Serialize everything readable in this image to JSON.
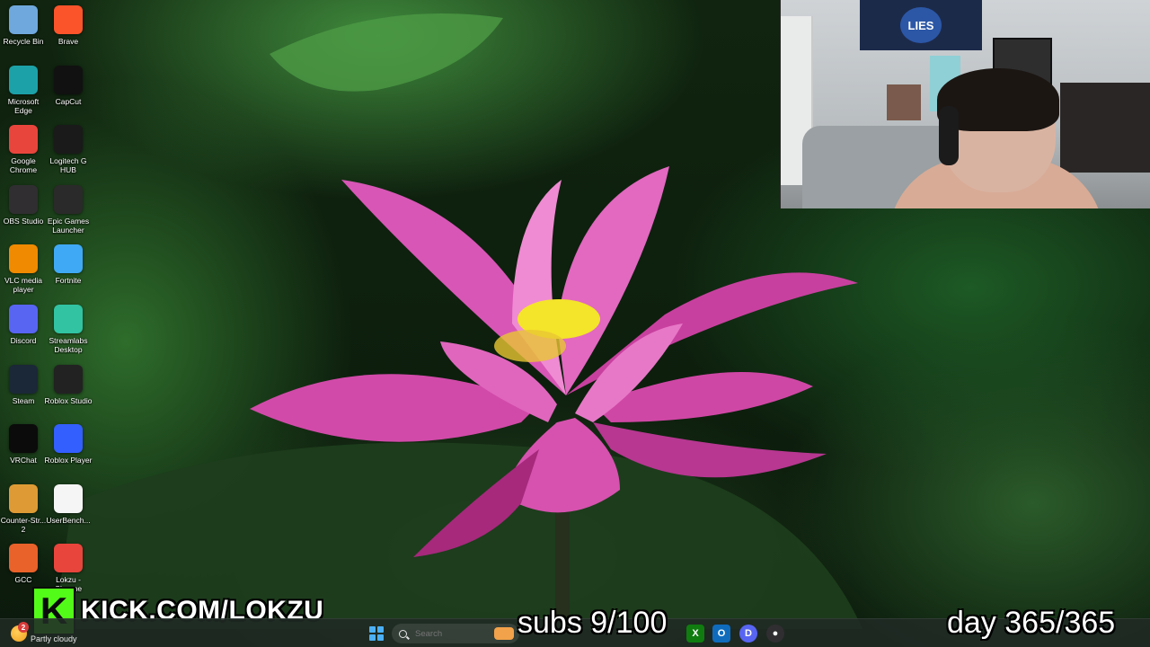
{
  "desktop": {
    "icons": [
      {
        "label": "Recycle Bin",
        "icon": "recycle-bin-icon",
        "color": "#6fa8dc"
      },
      {
        "label": "Brave",
        "icon": "brave-icon",
        "color": "#fb542b"
      },
      {
        "label": "Microsoft Edge",
        "icon": "edge-icon",
        "color": "#1da1a8"
      },
      {
        "label": "CapCut",
        "icon": "capcut-icon",
        "color": "#111111"
      },
      {
        "label": "Google Chrome",
        "icon": "chrome-icon",
        "color": "#e8453c"
      },
      {
        "label": "Logitech G HUB",
        "icon": "logitech-ghub-icon",
        "color": "#1a1a1a"
      },
      {
        "label": "OBS Studio",
        "icon": "obs-icon",
        "color": "#302e31"
      },
      {
        "label": "Epic Games Launcher",
        "icon": "epic-games-icon",
        "color": "#2a2a2a"
      },
      {
        "label": "VLC media player",
        "icon": "vlc-icon",
        "color": "#f08a00"
      },
      {
        "label": "Fortnite",
        "icon": "fortnite-icon",
        "color": "#3fa9f5"
      },
      {
        "label": "Discord",
        "icon": "discord-icon",
        "color": "#5865f2"
      },
      {
        "label": "Streamlabs Desktop",
        "icon": "streamlabs-icon",
        "color": "#31c3a2"
      },
      {
        "label": "Steam",
        "icon": "steam-icon",
        "color": "#1b2838"
      },
      {
        "label": "Roblox Studio",
        "icon": "roblox-studio-icon",
        "color": "#222222"
      },
      {
        "label": "VRChat",
        "icon": "vrchat-icon",
        "color": "#0b0b0b"
      },
      {
        "label": "Roblox Player",
        "icon": "roblox-player-icon",
        "color": "#335fff"
      },
      {
        "label": "Counter-Str... 2",
        "icon": "counter-strike-icon",
        "color": "#de9b35"
      },
      {
        "label": "UserBench...",
        "icon": "userbenchmark-icon",
        "color": "#f5f5f5"
      },
      {
        "label": "GCC",
        "icon": "gcc-icon",
        "color": "#e8622a"
      },
      {
        "label": "Lokzu - Chrome",
        "icon": "chrome-profile-icon",
        "color": "#e8453c"
      }
    ]
  },
  "overlay": {
    "kick_logo_letter": "K",
    "kick_url": "KICK.COM/LOKZU",
    "subs_text": "subs 9/100",
    "day_text": "day 365/365",
    "webcam_poster_text": "LIES"
  },
  "taskbar": {
    "weather_badge": "2",
    "weather_text": "Partly cloudy",
    "search_placeholder": "Search",
    "apps": [
      {
        "icon": "windows-start-icon"
      },
      {
        "icon": "search-icon"
      },
      {
        "icon": "xbox-icon",
        "color": "#107c10"
      },
      {
        "icon": "outlook-icon",
        "color": "#0f6cbd"
      },
      {
        "icon": "discord-icon",
        "color": "#5865f2"
      },
      {
        "icon": "obs-icon",
        "color": "#302e31"
      }
    ]
  }
}
